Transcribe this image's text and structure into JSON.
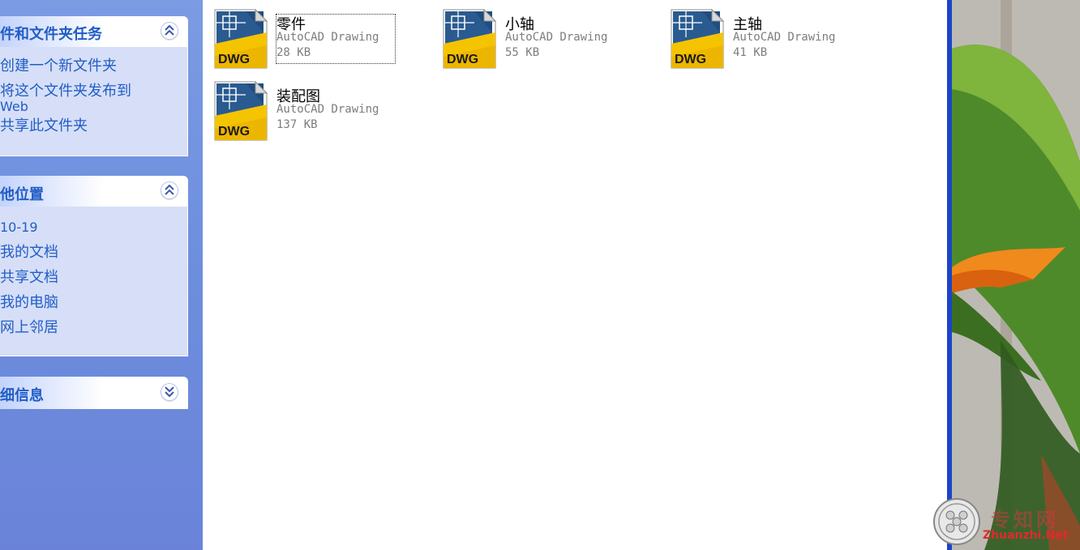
{
  "task_pane": {
    "file_tasks": {
      "title": "件和文件夹任务",
      "links": [
        "创建一个新文件夹",
        "将这个文件夹发布到",
        "Web",
        "共享此文件夹"
      ]
    },
    "other_places": {
      "title": "他位置",
      "links": [
        "10-19",
        "我的文档",
        "共享文档",
        "我的电脑",
        "网上邻居"
      ]
    },
    "details": {
      "title": "细信息"
    }
  },
  "files": [
    {
      "name": "零件",
      "type": "AutoCAD Drawing",
      "size": "28 KB",
      "icon_label": "DWG",
      "selected": true
    },
    {
      "name": "小轴",
      "type": "AutoCAD Drawing",
      "size": "55 KB",
      "icon_label": "DWG"
    },
    {
      "name": "主轴",
      "type": "AutoCAD Drawing",
      "size": "41 KB",
      "icon_label": "DWG"
    },
    {
      "name": "装配图",
      "type": "AutoCAD Drawing",
      "size": "137 KB",
      "icon_label": "DWG"
    }
  ],
  "watermark": {
    "site": "Zhuanzhi.Net",
    "cn": "专知网"
  },
  "colors": {
    "taskpane_bg": "#6d8edd",
    "link": "#215dc6",
    "dwg_yellow": "#f5c400",
    "dwg_blue": "#1e4f86",
    "window_border": "#1b44c8"
  }
}
